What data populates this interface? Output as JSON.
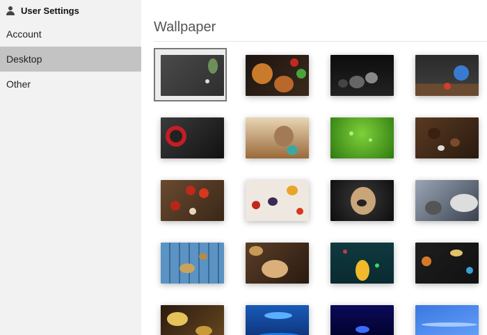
{
  "sidebar": {
    "header": {
      "icon": "user-icon",
      "label": "User Settings"
    },
    "items": [
      {
        "label": "Account",
        "active": false
      },
      {
        "label": "Desktop",
        "active": true
      },
      {
        "label": "Other",
        "active": false
      }
    ]
  },
  "main": {
    "title": "Wallpaper",
    "selected_index": 0,
    "wallpapers": [
      "slate-rosemary-wallpaper",
      "pies-apples-wallpaper",
      "dark-spheres-wallpaper",
      "globe-books-wallpaper",
      "start-button-wallpaper",
      "cat-yarn-wallpaper",
      "green-apple-drops-wallpaper",
      "chestnuts-wood-wallpaper",
      "apples-crate-wallpaper",
      "breakfast-berries-wallpaper",
      "pug-portrait-wallpaper",
      "scales-books-wallpaper",
      "blue-wood-planks-wallpaper",
      "bread-wheat-wallpaper",
      "kid-reading-wallpaper",
      "spices-chalkboard-wallpaper",
      "gold-coins-wallpaper",
      "blue-tech-wallpaper",
      "dark-blue-lights-wallpaper",
      "blue-wave-wallpaper"
    ]
  }
}
